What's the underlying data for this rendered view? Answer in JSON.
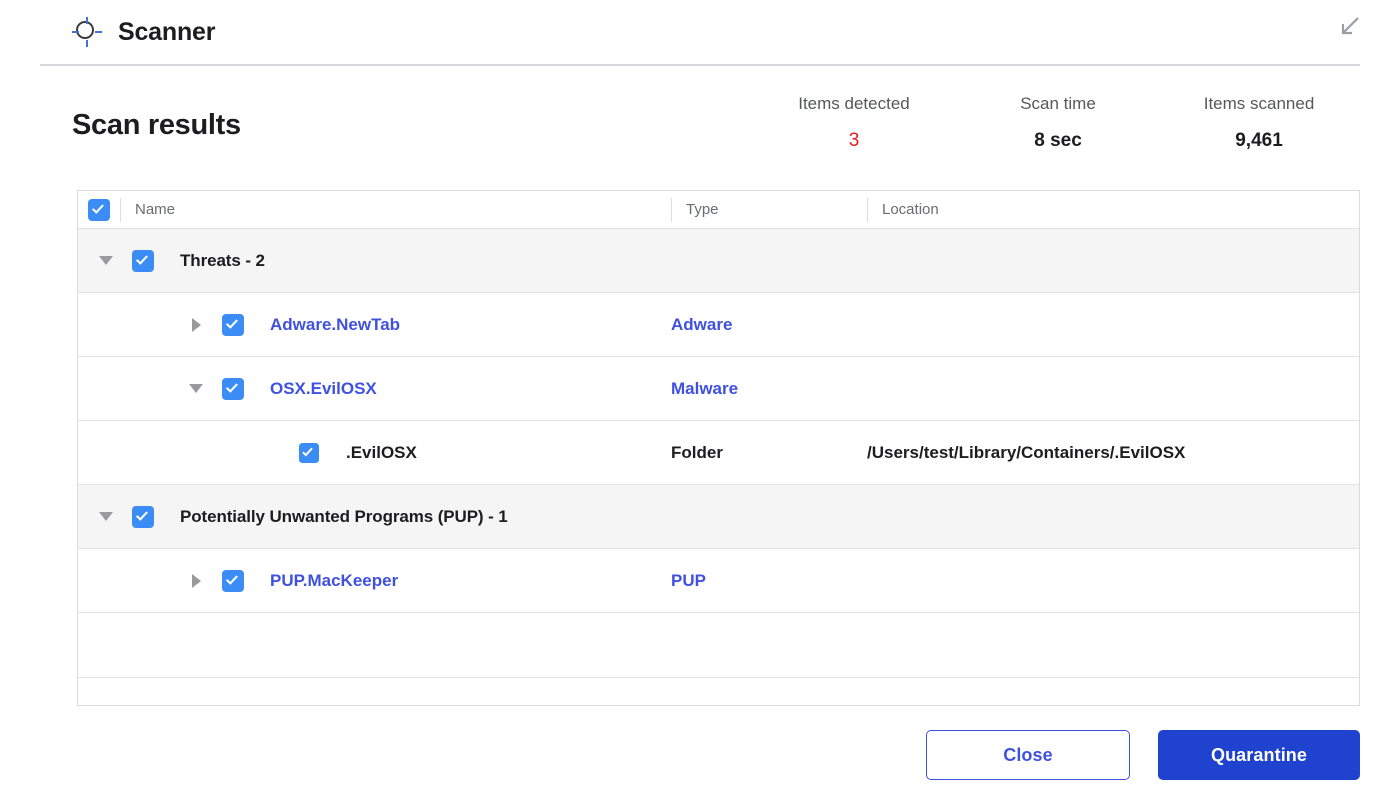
{
  "window": {
    "title": "Scanner",
    "icon": "crosshair-icon",
    "collapse_icon": "arrow-down-left-icon"
  },
  "summary": {
    "heading": "Scan results",
    "stats": [
      {
        "label": "Items detected",
        "value": "3",
        "color": "#e02020"
      },
      {
        "label": "Scan time",
        "value": "8 sec",
        "color": "#1d1d1f"
      },
      {
        "label": "Items scanned",
        "value": "9,461",
        "color": "#1d1d1f"
      }
    ]
  },
  "table": {
    "columns": {
      "name": "Name",
      "type": "Type",
      "location": "Location"
    },
    "select_all_checked": true,
    "rows": [
      {
        "kind": "group",
        "name": "Threats - 2",
        "type": "",
        "location": "",
        "checked": true,
        "expanded": true
      },
      {
        "kind": "threat",
        "name": "Adware.NewTab",
        "type": "Adware",
        "location": "",
        "checked": true,
        "expanded": false
      },
      {
        "kind": "threat",
        "name": "OSX.EvilOSX",
        "type": "Malware",
        "location": "",
        "checked": true,
        "expanded": true
      },
      {
        "kind": "child",
        "name": ".EvilOSX",
        "type": "Folder",
        "location": "/Users/test/Library/Containers/.EvilOSX",
        "checked": true
      },
      {
        "kind": "group",
        "name": "Potentially Unwanted Programs (PUP) - 1",
        "type": "",
        "location": "",
        "checked": true,
        "expanded": true
      },
      {
        "kind": "threat",
        "name": "PUP.MacKeeper",
        "type": "PUP",
        "location": "",
        "checked": true,
        "expanded": false
      }
    ]
  },
  "footer": {
    "close_label": "Close",
    "quarantine_label": "Quarantine"
  },
  "colors": {
    "accent_blue": "#3f51e0",
    "primary_button": "#1f42cf",
    "checkbox_blue": "#3b8cf5",
    "danger_red": "#e02020"
  }
}
